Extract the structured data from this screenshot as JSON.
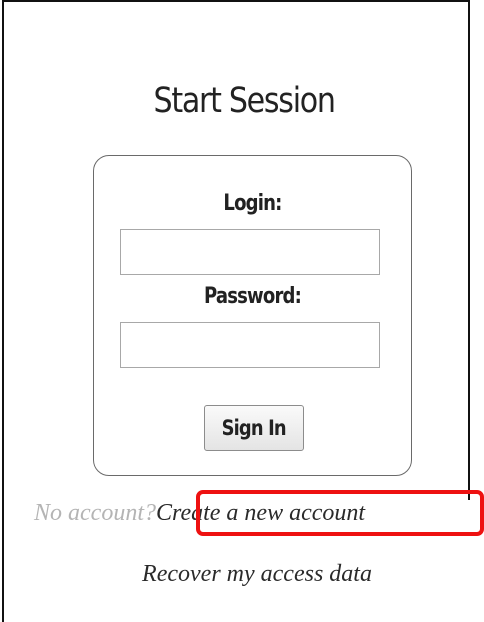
{
  "page": {
    "title": "Start Session"
  },
  "login_form": {
    "login_label": "Login:",
    "login_value": "",
    "password_label": "Password:",
    "password_value": "",
    "signin_label": "Sign In"
  },
  "footer": {
    "no_account_text": "No account?",
    "create_account_label": "Create a new account",
    "recover_label": "Recover my access data"
  },
  "colors": {
    "highlight": "#ee1111",
    "muted_text": "#b4b4b4",
    "link_text": "#2a2a2a"
  }
}
